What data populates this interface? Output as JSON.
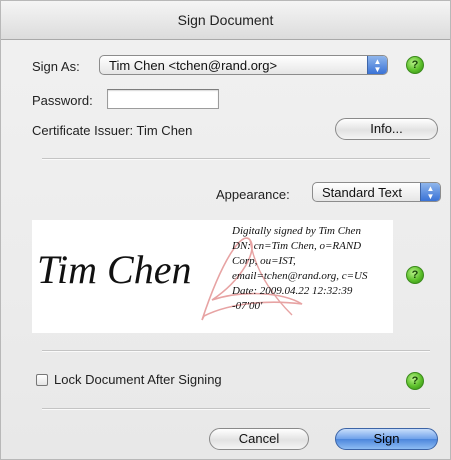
{
  "dialog": {
    "title": "Sign Document"
  },
  "sign_as": {
    "label": "Sign As:",
    "selected": "Tim Chen <tchen@rand.org>"
  },
  "password": {
    "label": "Password:",
    "value": ""
  },
  "certificate": {
    "label": "Certificate Issuer: Tim Chen",
    "info_button": "Info..."
  },
  "appearance": {
    "label": "Appearance:",
    "selected": "Standard Text"
  },
  "signature_preview": {
    "name": "Tim Chen",
    "details": [
      "Digitally signed by Tim Chen",
      "DN: cn=Tim Chen, o=RAND",
      "Corp, ou=IST,",
      "email=tchen@rand.org, c=US",
      "Date: 2009.04.22 12:32:39",
      "-07'00'"
    ]
  },
  "lock": {
    "label": "Lock Document After Signing",
    "checked": false
  },
  "buttons": {
    "cancel": "Cancel",
    "sign": "Sign"
  },
  "icons": {
    "help": "help-icon",
    "popup_arrows": "popup-arrows-icon",
    "watermark": "adobe-logo-watermark"
  },
  "colors": {
    "accent_blue": "#4c86dc",
    "help_green": "#5cbf2a"
  }
}
